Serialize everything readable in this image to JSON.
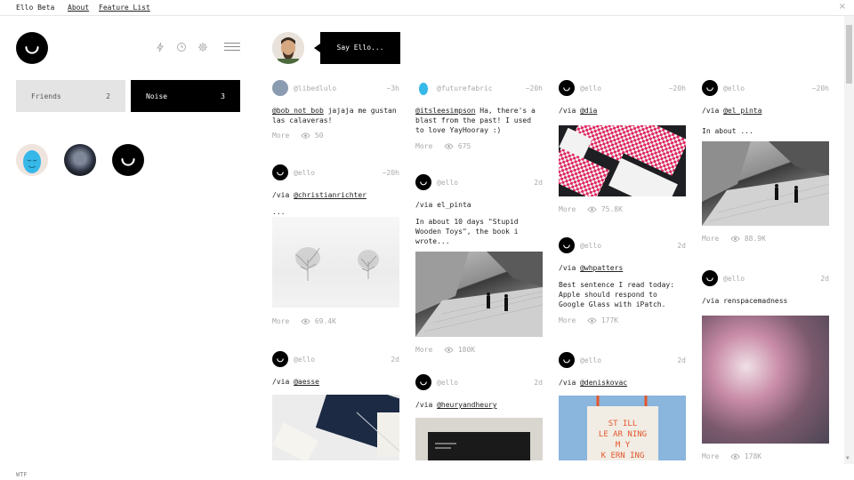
{
  "topbar": {
    "brand": "Ello Beta",
    "about": "About",
    "feature_list": "Feature List",
    "close": "×"
  },
  "sidebar": {
    "streams": [
      {
        "label": "Friends",
        "count": "2"
      },
      {
        "label": "Noise",
        "count": "3"
      }
    ],
    "footer": "WTF"
  },
  "composer": {
    "say_label": "Say Ello..."
  },
  "posts": [
    {
      "user": "@libedlulo",
      "time": "~3h",
      "mention": "@bob_not_bob",
      "text": " jajaja me gustan las calaveras!",
      "more": "More",
      "views": "50"
    },
    {
      "user": "@ello",
      "time": "~20h",
      "via": "/via ",
      "via_user": "@christianrichter",
      "text": "...",
      "more": "More",
      "views": "69.4K"
    },
    {
      "user": "@ello",
      "time": "2d",
      "via": "/via ",
      "via_user": "@aesse"
    },
    {
      "user": "@futurefabric",
      "time": "~20h",
      "mention": "@itsleesimpson",
      "text": " Ha, there's a blast from the past! I used to love YayHooray :)",
      "more": "More",
      "views": "675"
    },
    {
      "user": "@ello",
      "time": "2d",
      "via": "/via el_pinta",
      "text": "In about 10 days \"Stupid Wooden Toys\", the book i wrote...",
      "more": "More",
      "views": "180K"
    },
    {
      "user": "@ello",
      "time": "2d",
      "via": "/via ",
      "via_user": "@heuryandheury"
    },
    {
      "user": "@ello",
      "time": "~20h",
      "via": "/via ",
      "via_user": "@dia",
      "more": "More",
      "views": "75.8K"
    },
    {
      "user": "@ello",
      "time": "2d",
      "via": "/via ",
      "via_user": "@whpatters",
      "text": "Best sentence I read today: Apple should respond to Google Glass with iPatch.",
      "more": "More",
      "views": "177K"
    },
    {
      "user": "@ello",
      "time": "2d",
      "via": "/via ",
      "via_user": "@deniskovac",
      "tote_text": "STILL LEARNING MY KERNING"
    },
    {
      "user": "@ello",
      "time": "~20h",
      "via": "/via ",
      "via_user": "@el_pinta",
      "text": "In about ...",
      "more": "More",
      "views": "88.9K"
    },
    {
      "user": "@ello",
      "time": "2d",
      "via": "/via renspacemadness",
      "more": "More",
      "views": "178K"
    }
  ],
  "icons": {
    "logo": "ello-smile-logo",
    "tools": [
      "bolt-icon",
      "clock-icon",
      "gear-icon",
      "hamburger-menu-icon"
    ],
    "views": "eye-icon"
  },
  "colors": {
    "accent": "#000000",
    "muted": "#aaaaaa",
    "tab_inactive": "#e4e4e4"
  }
}
